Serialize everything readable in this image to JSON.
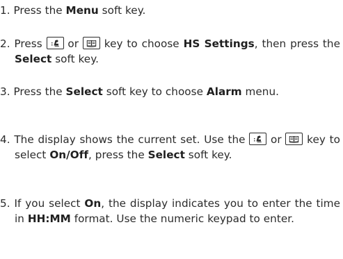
{
  "steps": [
    {
      "num": "1.",
      "parts": [
        "Press the ",
        "Menu",
        " soft key."
      ]
    },
    {
      "num": "2.",
      "parts": [
        "Press ",
        " or ",
        " key to choose ",
        "HS Settings",
        ", then press the ",
        "Select",
        " soft key."
      ]
    },
    {
      "num": "3.",
      "parts": [
        "Press the ",
        "Select",
        " soft key to choose ",
        "Alarm",
        " menu."
      ]
    },
    {
      "num": "4.",
      "parts": [
        "The display shows the current set. Use the ",
        " or ",
        " key to select ",
        "On",
        "/",
        "Off",
        ", press the ",
        "Select",
        " soft key."
      ]
    },
    {
      "num": "5.",
      "parts": [
        "If you select ",
        "On",
        ", the display indicates you to enter the time in ",
        "HH",
        ":",
        "MM",
        " format. Use the numeric keypad to enter."
      ]
    }
  ],
  "icons": {
    "key_1": "phonebook-key-icon",
    "key_2": "book-key-icon"
  }
}
